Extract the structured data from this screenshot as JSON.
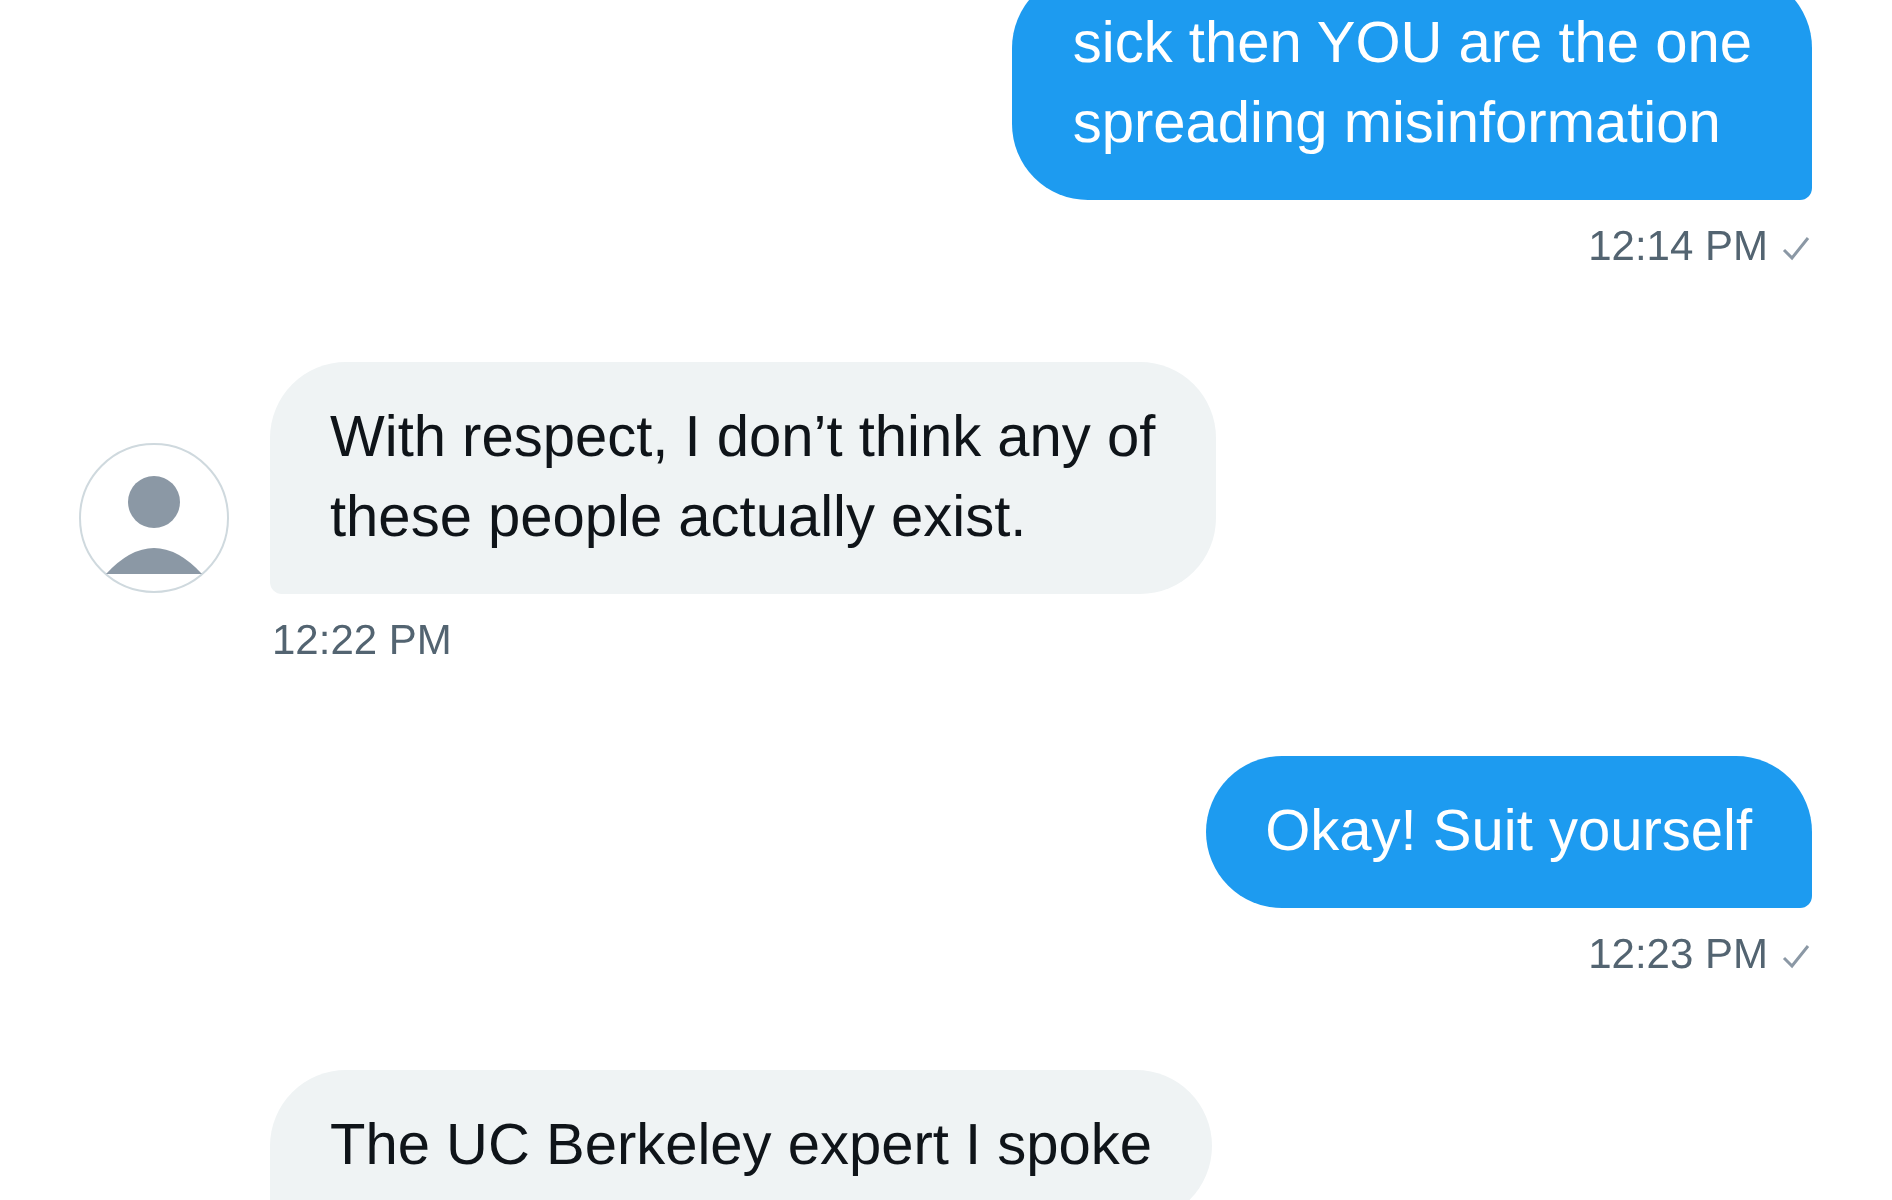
{
  "messages": [
    {
      "kind": "sent",
      "lines": [
        "sick then YOU are the one",
        "spreading misinformation"
      ],
      "time": "12:14 PM"
    },
    {
      "kind": "received",
      "lines": [
        "With respect, I don’t think any of",
        "these people actually exist."
      ],
      "time": "12:22 PM"
    },
    {
      "kind": "sent",
      "lines": [
        "Okay! Suit yourself"
      ],
      "time": "12:23 PM"
    },
    {
      "kind": "received",
      "lines": [
        "The UC Berkeley expert I spoke"
      ]
    }
  ]
}
